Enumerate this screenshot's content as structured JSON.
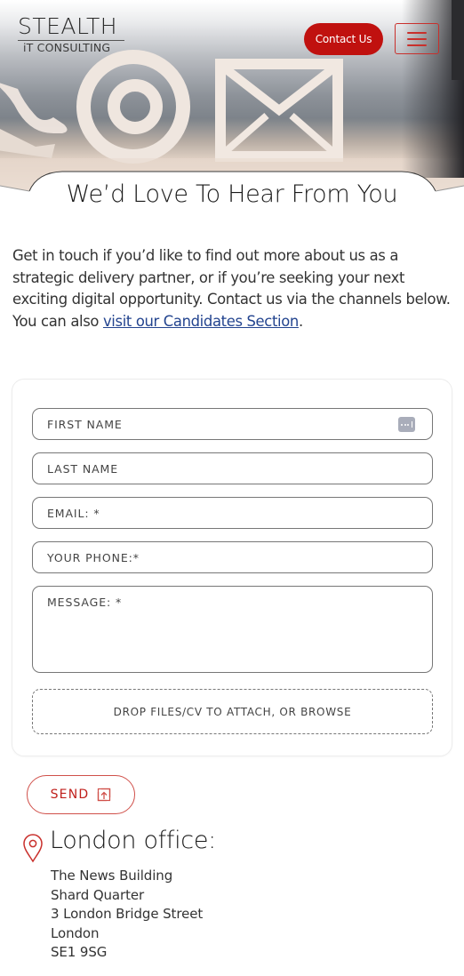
{
  "header": {
    "logo": {
      "main": "STEALTH",
      "sub": "iT CONSULTING"
    },
    "contact_button": "Contact Us",
    "menu_icon": "hamburger-menu-icon"
  },
  "hero": {
    "title": "We’d Love To Hear From You",
    "image_icons": [
      "phone-icon",
      "at-sign-icon",
      "envelope-icon"
    ]
  },
  "intro": {
    "text": "Get in touch if you’d like to find out more about us as a strategic delivery partner, or if you’re seeking your next exciting digital opportunity. Contact us via the channels below. You can also ",
    "link_text": "visit our Candidates Section",
    "trailing": "."
  },
  "form": {
    "fields": [
      {
        "name": "first-name",
        "placeholder": "FIRST NAME",
        "value": "",
        "autofill_icon": "autofill-contact-icon"
      },
      {
        "name": "last-name",
        "placeholder": "LAST NAME",
        "value": ""
      },
      {
        "name": "email",
        "placeholder": "EMAIL: *",
        "value": ""
      },
      {
        "name": "phone",
        "placeholder": "YOUR PHONE:*",
        "value": ""
      },
      {
        "name": "message",
        "placeholder": "MESSAGE: *",
        "value": ""
      }
    ],
    "dropzone_label": "DROP FILES/CV TO ATTACH, OR BROWSE",
    "send_label": "SEND",
    "send_icon": "upload-icon"
  },
  "office": {
    "title": "London office:",
    "icon": "map-pin-icon",
    "address_lines": [
      "The News Building",
      "Shard Quarter",
      "3 London Bridge Street",
      "London",
      "SE1 9SG"
    ]
  },
  "colors": {
    "brand_red": "#c0110f",
    "link_blue": "#23448f",
    "outline_red": "#d0504a"
  }
}
